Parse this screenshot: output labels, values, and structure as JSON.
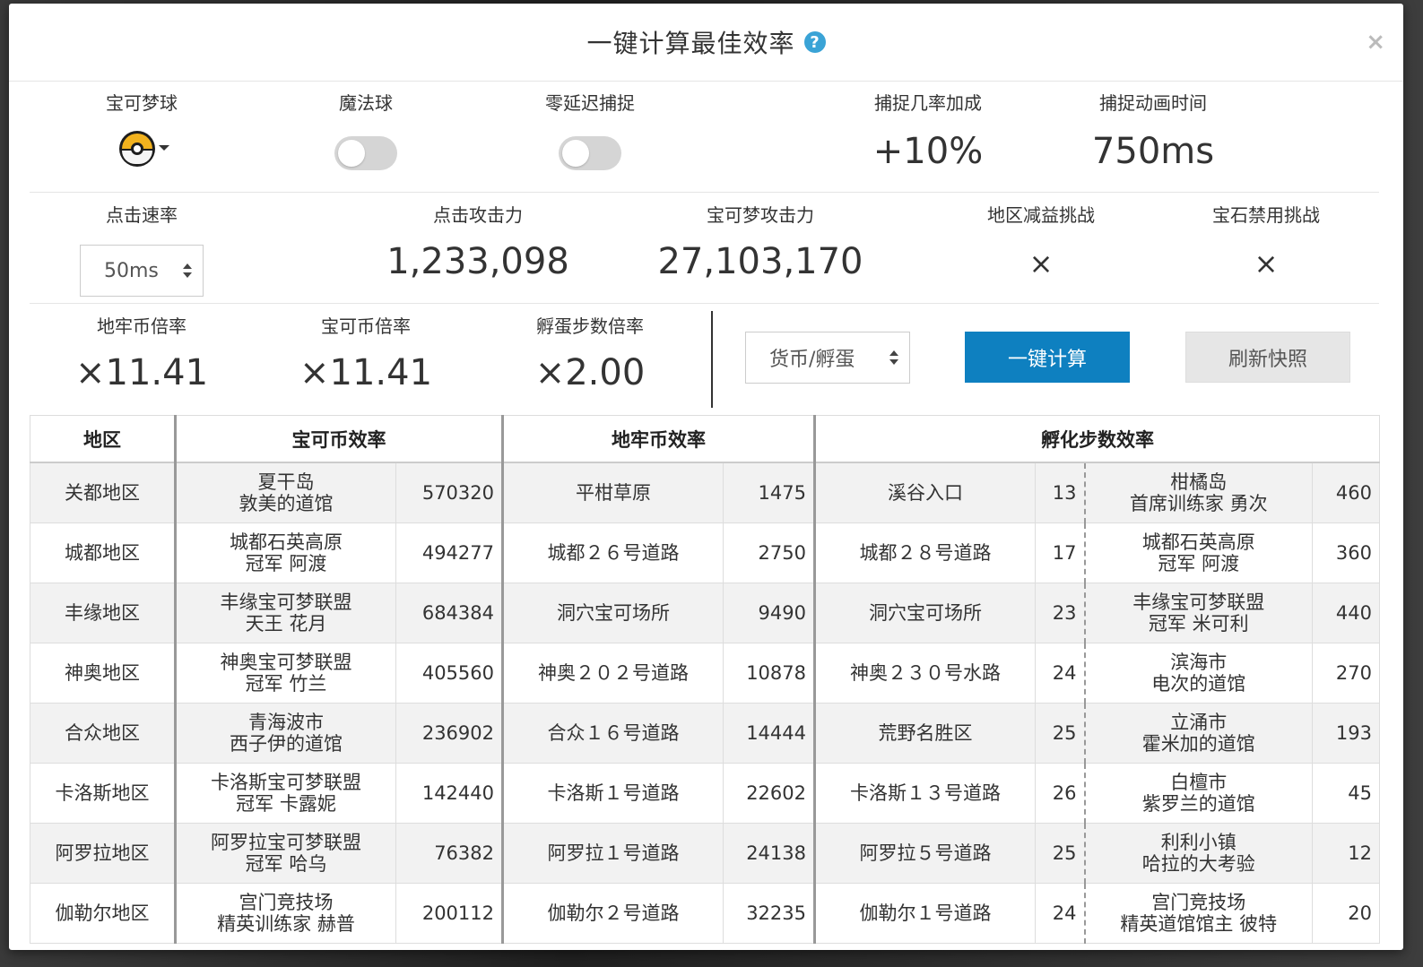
{
  "modal": {
    "title": "一键计算最佳效率",
    "help_icon": "?",
    "close_icon": "×"
  },
  "row1": {
    "pokeball_label": "宝可梦球",
    "magic_ball_label": "魔法球",
    "magic_ball_on": false,
    "zero_delay_label": "零延迟捕捉",
    "zero_delay_on": false,
    "catch_bonus_label": "捕捉几率加成",
    "catch_bonus_value": "+10%",
    "catch_anim_label": "捕捉动画时间",
    "catch_anim_value": "750ms"
  },
  "row2": {
    "click_rate_label": "点击速率",
    "click_rate_value": "50ms",
    "click_attack_label": "点击攻击力",
    "click_attack_value": "1,233,098",
    "poke_attack_label": "宝可梦攻击力",
    "poke_attack_value": "27,103,170",
    "region_debuff_label": "地区减益挑战",
    "region_debuff_value": "×",
    "gem_ban_label": "宝石禁用挑战",
    "gem_ban_value": "×"
  },
  "row3": {
    "dungeon_mult_label": "地牢币倍率",
    "dungeon_mult_value": "×11.41",
    "coin_mult_label": "宝可币倍率",
    "coin_mult_value": "×11.41",
    "egg_mult_label": "孵蛋步数倍率",
    "egg_mult_value": "×2.00",
    "mode_select_value": "货币/孵蛋",
    "calc_button": "一键计算",
    "refresh_button": "刷新快照"
  },
  "table": {
    "headers": {
      "region": "地区",
      "coin": "宝可币效率",
      "dungeon": "地牢币效率",
      "hatch": "孵化步数效率"
    },
    "rows": [
      {
        "region": "关都地区",
        "coin_loc1": "夏干岛",
        "coin_loc2": "敦美的道馆",
        "coin_val": "570320",
        "dungeon_loc": "平柑草原",
        "dungeon_val": "1475",
        "hatch_a_loc": "溪谷入口",
        "hatch_a_val": "13",
        "hatch_b_loc1": "柑橘岛",
        "hatch_b_loc2": "首席训练家 勇次",
        "hatch_b_val": "460"
      },
      {
        "region": "城都地区",
        "coin_loc1": "城都石英高原",
        "coin_loc2": "冠军 阿渡",
        "coin_val": "494277",
        "dungeon_loc": "城都２６号道路",
        "dungeon_val": "2750",
        "hatch_a_loc": "城都２８号道路",
        "hatch_a_val": "17",
        "hatch_b_loc1": "城都石英高原",
        "hatch_b_loc2": "冠军 阿渡",
        "hatch_b_val": "360"
      },
      {
        "region": "丰缘地区",
        "coin_loc1": "丰缘宝可梦联盟",
        "coin_loc2": "天王 花月",
        "coin_val": "684384",
        "dungeon_loc": "洞穴宝可场所",
        "dungeon_val": "9490",
        "hatch_a_loc": "洞穴宝可场所",
        "hatch_a_val": "23",
        "hatch_b_loc1": "丰缘宝可梦联盟",
        "hatch_b_loc2": "冠军 米可利",
        "hatch_b_val": "440"
      },
      {
        "region": "神奥地区",
        "coin_loc1": "神奥宝可梦联盟",
        "coin_loc2": "冠军 竹兰",
        "coin_val": "405560",
        "dungeon_loc": "神奥２０２号道路",
        "dungeon_val": "10878",
        "hatch_a_loc": "神奥２３０号水路",
        "hatch_a_val": "24",
        "hatch_b_loc1": "滨海市",
        "hatch_b_loc2": "电次的道馆",
        "hatch_b_val": "270"
      },
      {
        "region": "合众地区",
        "coin_loc1": "青海波市",
        "coin_loc2": "西子伊的道馆",
        "coin_val": "236902",
        "dungeon_loc": "合众１６号道路",
        "dungeon_val": "14444",
        "hatch_a_loc": "荒野名胜区",
        "hatch_a_val": "25",
        "hatch_b_loc1": "立涌市",
        "hatch_b_loc2": "霍米加的道馆",
        "hatch_b_val": "193"
      },
      {
        "region": "卡洛斯地区",
        "coin_loc1": "卡洛斯宝可梦联盟",
        "coin_loc2": "冠军 卡露妮",
        "coin_val": "142440",
        "dungeon_loc": "卡洛斯１号道路",
        "dungeon_val": "22602",
        "hatch_a_loc": "卡洛斯１３号道路",
        "hatch_a_val": "26",
        "hatch_b_loc1": "白檀市",
        "hatch_b_loc2": "紫罗兰的道馆",
        "hatch_b_val": "45"
      },
      {
        "region": "阿罗拉地区",
        "coin_loc1": "阿罗拉宝可梦联盟",
        "coin_loc2": "冠军 哈乌",
        "coin_val": "76382",
        "dungeon_loc": "阿罗拉１号道路",
        "dungeon_val": "24138",
        "hatch_a_loc": "阿罗拉５号道路",
        "hatch_a_val": "25",
        "hatch_b_loc1": "利利小镇",
        "hatch_b_loc2": "哈拉的大考验",
        "hatch_b_val": "12"
      },
      {
        "region": "伽勒尔地区",
        "coin_loc1": "宫门竞技场",
        "coin_loc2": "精英训练家 赫普",
        "coin_val": "200112",
        "dungeon_loc": "伽勒尔２号道路",
        "dungeon_val": "32235",
        "hatch_a_loc": "伽勒尔１号道路",
        "hatch_a_val": "24",
        "hatch_b_loc1": "宫门竞技场",
        "hatch_b_loc2": "精英道馆馆主 彼特",
        "hatch_b_val": "20"
      }
    ]
  }
}
